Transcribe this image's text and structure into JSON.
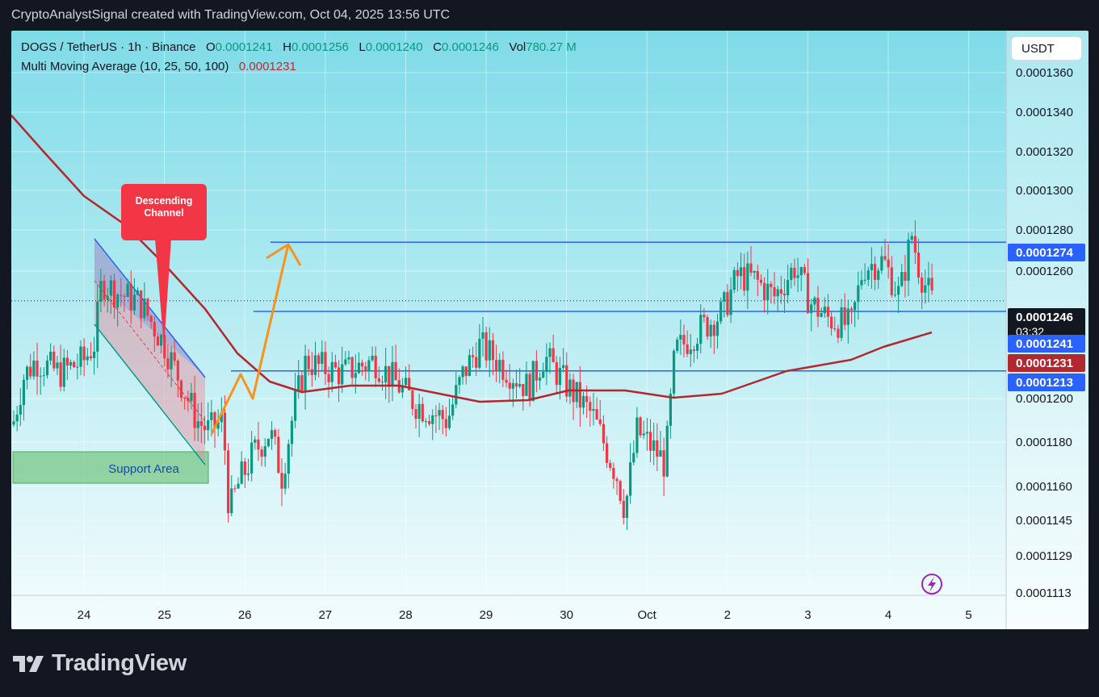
{
  "caption": "CryptoAnalystSignal created with TradingView.com, Oct 04, 2025 13:56 UTC",
  "brand": "TradingView",
  "legend": {
    "symbol": "DOGS / TetherUS · 1h · Binance",
    "o_label": "O",
    "o": "0.0001241",
    "h_label": "H",
    "h": "0.0001256",
    "l_label": "L",
    "l": "0.0001240",
    "c_label": "C",
    "c": "0.0001246",
    "vol_label": "Vol",
    "vol": "780.27 M",
    "ma_name": "Multi Moving Average (10, 25, 50, 100)",
    "ma_value": "0.0001231"
  },
  "currency_button": "USDT",
  "colors": {
    "up": "#089981",
    "down": "#f23645",
    "ma": "#b2282f",
    "line": "#2962ff",
    "arrow": "#f7931a",
    "callout": "#f23645",
    "support": "#4caf50"
  },
  "chart_data": {
    "type": "candlestick",
    "x_labels": [
      "24",
      "25",
      "26",
      "27",
      "28",
      "29",
      "30",
      "Oct",
      "2",
      "3",
      "4",
      "5"
    ],
    "y_ticks": [
      "0.0001360",
      "0.0001340",
      "0.0001320",
      "0.0001300",
      "0.0001280",
      "0.0001260",
      "0.0001200",
      "0.0001180",
      "0.0001160",
      "0.0001145",
      "0.0001129",
      "0.0001113"
    ],
    "y_range": [
      0.0001113,
      0.000136
    ],
    "price_labels": [
      {
        "text": "0.0001274",
        "kind": "level"
      },
      {
        "text": "0.0001246",
        "kind": "last",
        "sub": "03:32"
      },
      {
        "text": "0.0001241",
        "kind": "level"
      },
      {
        "text": "0.0001231",
        "kind": "ma"
      },
      {
        "text": "0.0001213",
        "kind": "level"
      }
    ],
    "resistance_levels": [
      0.0001274,
      0.0001241,
      0.0001213
    ],
    "annotations": {
      "channel_label": "Descending Channel",
      "support_label": "Support Area"
    }
  }
}
